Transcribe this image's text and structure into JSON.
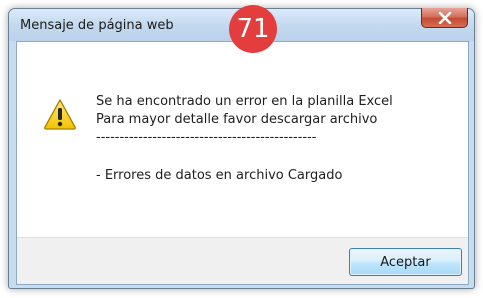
{
  "window": {
    "title": "Mensaje de página web",
    "badge": "71",
    "close_icon": "close-x-icon"
  },
  "message": {
    "icon": "warning-icon",
    "lines": [
      "Se ha encontrado un error en la planilla Excel",
      "Para mayor detalle favor descargar archivo",
      "-----------------------------------------------",
      "- Errores de datos en archivo Cargado"
    ]
  },
  "buttons": {
    "ok_label": "Aceptar"
  },
  "colors": {
    "badge": "#e33d3d",
    "close_button": "#c44b36",
    "warning_triangle": "#f2c200",
    "ok_button_border": "#3c7fb1"
  }
}
